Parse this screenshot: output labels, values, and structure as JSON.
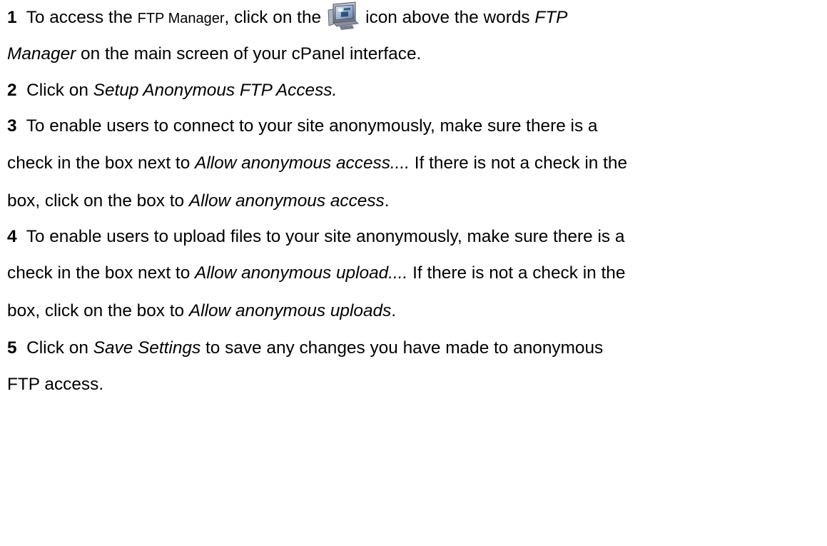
{
  "steps": [
    {
      "num": "1",
      "lines": [
        {
          "t1": "To access the ",
          "t2": "FTP Manager",
          "t3": ", click on the",
          "t4": "icon above the words ",
          "t5": "FTP"
        },
        {
          "t1": "Manager",
          "t2": " on the main screen of your cPanel interface."
        }
      ]
    },
    {
      "num": "2",
      "t1": "Click on ",
      "t2": "Setup Anonymous FTP Access."
    },
    {
      "num": "3",
      "lines": [
        {
          "t1": "To enable users to connect to your site anonymously, make sure there is a"
        },
        {
          "t1": "check in the box next to ",
          "t2": "Allow anonymous access....",
          "t3": " If there is not a check in the"
        },
        {
          "t1": "box, click on the box to ",
          "t2": "Allow anonymous access",
          "t3": "."
        }
      ]
    },
    {
      "num": "4",
      "lines": [
        {
          "t1": "To enable users to upload files to your site anonymously, make sure there is a"
        },
        {
          "t1": "check in the box next to ",
          "t2": "Allow anonymous upload....",
          "t3": " If there is not a check in the"
        },
        {
          "t1": "box, click on the box to ",
          "t2": "Allow anonymous uploads",
          "t3": "."
        }
      ]
    },
    {
      "num": "5",
      "lines": [
        {
          "t1": "Click on ",
          "t2": "Save Settings",
          "t3": " to save any changes you have made to anonymous"
        },
        {
          "t1": "FTP access."
        }
      ]
    }
  ],
  "icon": "ftp-manager-icon"
}
